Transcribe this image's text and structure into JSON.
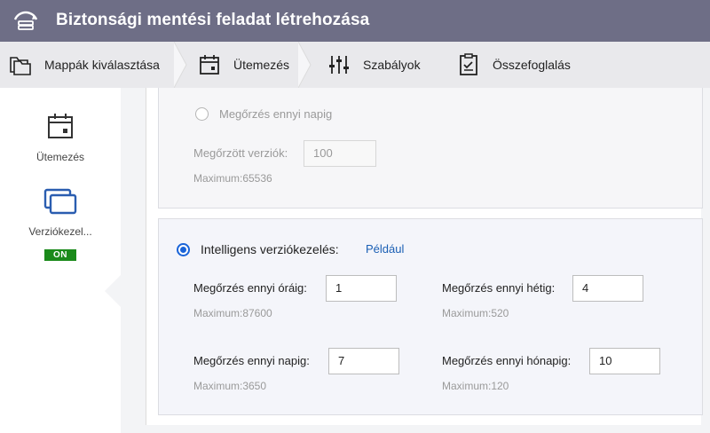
{
  "window": {
    "title": "Biztonsági mentési feladat létrehozása"
  },
  "wizard": {
    "steps": [
      {
        "label": "Mappák kiválasztása",
        "icon": "folders-icon"
      },
      {
        "label": "Ütemezés",
        "icon": "calendar-icon"
      },
      {
        "label": "Szabályok",
        "icon": "sliders-icon"
      },
      {
        "label": "Összefoglalás",
        "icon": "clipboard-icon"
      }
    ]
  },
  "sidebar": {
    "items": [
      {
        "label": "Ütemezés",
        "icon": "calendar-icon"
      },
      {
        "label": "Verziókezel...",
        "icon": "versions-icon",
        "badge": "ON"
      }
    ]
  },
  "top_section": {
    "retain_days_label": "Megőrzés ennyi napig",
    "retained_versions_label": "Megőrzött verziók:",
    "retained_versions_value": "100",
    "retained_versions_max": "Maximum:65536"
  },
  "smart_versioning": {
    "label": "Intelligens verziókezelés:",
    "example_link": "Például",
    "fields": {
      "hours": {
        "label": "Megőrzés ennyi óráig:",
        "value": "1",
        "max": "Maximum:87600"
      },
      "weeks": {
        "label": "Megőrzés ennyi hétig:",
        "value": "4",
        "max": "Maximum:520"
      },
      "days": {
        "label": "Megőrzés ennyi napig:",
        "value": "7",
        "max": "Maximum:3650"
      },
      "months": {
        "label": "Megőrzés ennyi hónapig:",
        "value": "10",
        "max": "Maximum:120"
      }
    }
  },
  "colors": {
    "titlebar": "#6e6e86",
    "accent": "#1a64d8",
    "link": "#1a5fb4",
    "badge_on": "#1a8a1a"
  }
}
